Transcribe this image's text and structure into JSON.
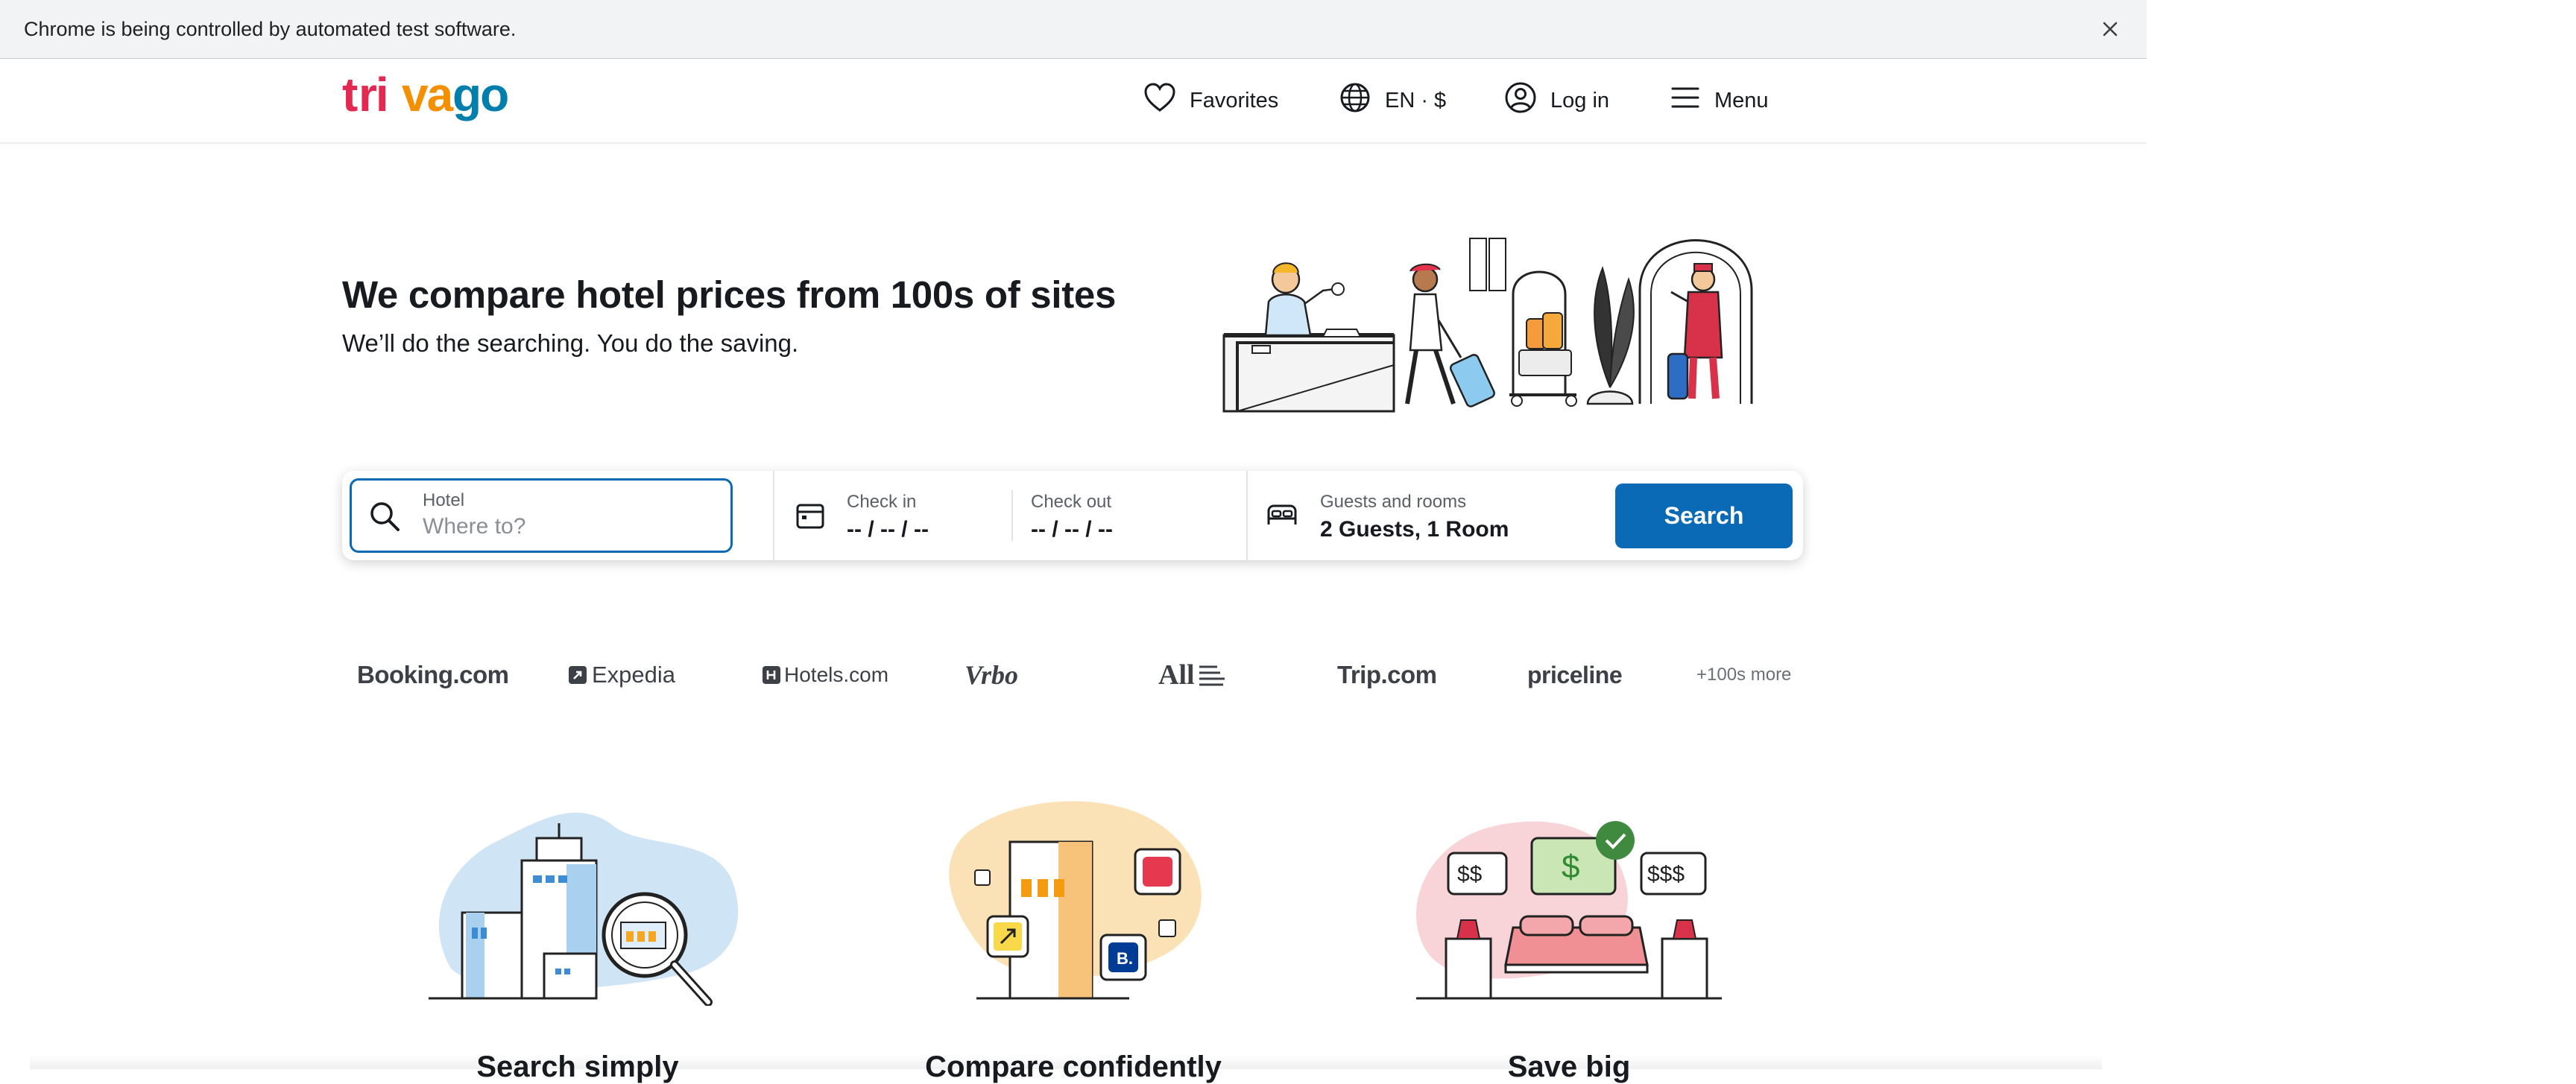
{
  "browser": {
    "infobar_text": "Chrome is being controlled by automated test software.",
    "close_icon": "close-icon"
  },
  "brand": {
    "logo_text": "trivago",
    "colors": {
      "t": "#e32851",
      "ri": "#e32851",
      "va": "#f48f00",
      "go": "#007fad",
      "accent": "#0a6ab6"
    }
  },
  "header": {
    "favorites_label": "Favorites",
    "language_label": "EN · $",
    "login_label": "Log in",
    "menu_label": "Menu"
  },
  "hero": {
    "title": "We compare hotel prices from 100s of sites",
    "subtitle": "We’ll do the searching. You do the saving."
  },
  "search": {
    "hotel_label": "Hotel",
    "hotel_placeholder": "Where to?",
    "checkin_label": "Check in",
    "checkin_value": "-- / -- / --",
    "checkout_label": "Check out",
    "checkout_value": "-- / -- / --",
    "guests_label": "Guests and rooms",
    "guests_value": "2 Guests, 1 Room",
    "search_button": "Search"
  },
  "partners": {
    "items": [
      "Booking.com",
      "Expedia",
      "Hotels.com",
      "Vrbo",
      "All",
      "Trip.com",
      "priceline"
    ],
    "more_label": "+100s more"
  },
  "features": [
    {
      "title": "Search simply"
    },
    {
      "title": "Compare confidently"
    },
    {
      "title": "Save big"
    }
  ],
  "save_illustration": {
    "left_tag": "$$",
    "center_tag": "$",
    "right_tag": "$$$"
  }
}
